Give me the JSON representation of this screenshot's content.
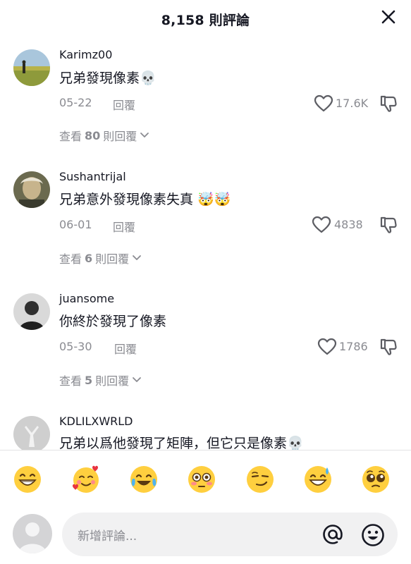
{
  "header": {
    "title": "8,158 則評論"
  },
  "comments": [
    {
      "username": "Karimz00",
      "text": "兄弟發現像素💀",
      "date": "05-22",
      "reply_label": "回覆",
      "likes": "17.6K",
      "view_replies_prefix": "查看",
      "view_replies_count": "80",
      "view_replies_suffix": "則回覆"
    },
    {
      "username": "Sushantrijal",
      "text": "兄弟意外發現像素失真 🤯🤯",
      "date": "06-01",
      "reply_label": "回覆",
      "likes": "4838",
      "view_replies_prefix": "查看",
      "view_replies_count": "6",
      "view_replies_suffix": "則回覆"
    },
    {
      "username": "juansome",
      "text": "你終於發現了像素",
      "date": "05-30",
      "reply_label": "回覆",
      "likes": "1786",
      "view_replies_prefix": "查看",
      "view_replies_count": "5",
      "view_replies_suffix": "則回覆"
    },
    {
      "username": "KDLILXWRLD",
      "text": "兄弟以爲他發現了矩陣，但它只是像素💀"
    }
  ],
  "emoji_bar": [
    "😁",
    "🥰",
    "😂",
    "😳",
    "😏",
    "😅",
    "🥺"
  ],
  "composer": {
    "placeholder": "新增評論..."
  },
  "colors": {
    "text_primary": "#161823",
    "text_secondary": "#8a8b91",
    "input_bg": "#f1f1f2"
  }
}
